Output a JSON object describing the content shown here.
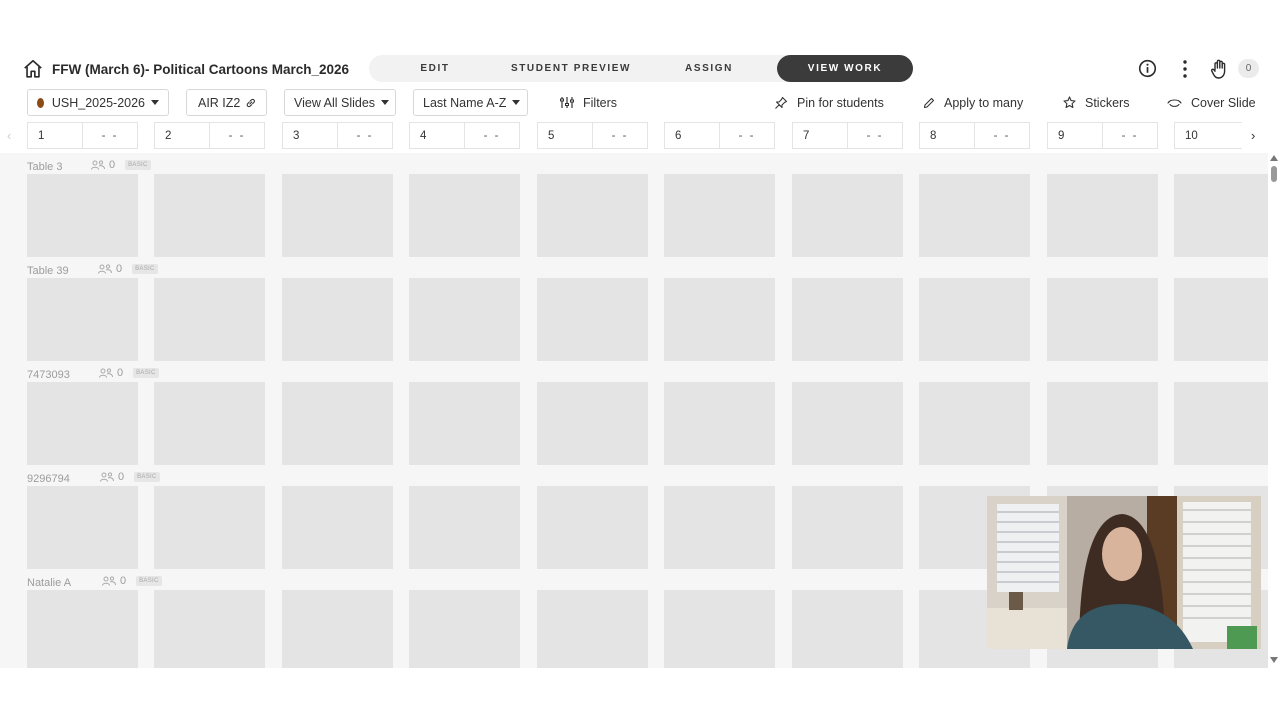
{
  "header": {
    "title": "FFW (March 6)- Political Cartoons March_2026",
    "tabs": [
      {
        "label": "EDIT",
        "active": false
      },
      {
        "label": "STUDENT PREVIEW",
        "active": false
      },
      {
        "label": "ASSIGN",
        "active": false
      },
      {
        "label": "VIEW WORK",
        "active": true
      }
    ],
    "hand_count": "0",
    "icons": {
      "home": "home-icon",
      "info": "info-icon",
      "more": "kebab-icon",
      "hand": "raised-hand-icon"
    }
  },
  "toolbar": {
    "class_select": "USH_2025-2026",
    "class_dot_color": "#8a4b17",
    "code_button": "AIR IZ2",
    "view_select": "View All Slides",
    "sort_select": "Last Name A-Z",
    "filters": "Filters",
    "pin": "Pin for students",
    "apply_many": "Apply to many",
    "stickers": "Stickers",
    "cover_slide": "Cover Slide"
  },
  "slides": [
    {
      "num": "1",
      "score": "- -"
    },
    {
      "num": "2",
      "score": "- -"
    },
    {
      "num": "3",
      "score": "- -"
    },
    {
      "num": "4",
      "score": "- -"
    },
    {
      "num": "5",
      "score": "- -"
    },
    {
      "num": "6",
      "score": "- -"
    },
    {
      "num": "7",
      "score": "- -"
    },
    {
      "num": "8",
      "score": "- -"
    },
    {
      "num": "9",
      "score": "- -"
    },
    {
      "num": "10",
      "score": ""
    }
  ],
  "nav": {
    "prev": "‹",
    "next": "›"
  },
  "students": [
    {
      "name": "Table 3",
      "hands": "0",
      "badge": "BASIC"
    },
    {
      "name": "Table 39",
      "hands": "0",
      "badge": "BASIC"
    },
    {
      "name": "7473093",
      "hands": "0",
      "badge": "BASIC"
    },
    {
      "name": "9296794",
      "hands": "0",
      "badge": "BASIC"
    },
    {
      "name": "Natalie A",
      "hands": "0",
      "badge": "BASIC"
    }
  ],
  "colors": {
    "accent_dark": "#3b3b3b",
    "thumb_bg": "#e4e4e4",
    "grid_bg": "#f6f6f6"
  }
}
